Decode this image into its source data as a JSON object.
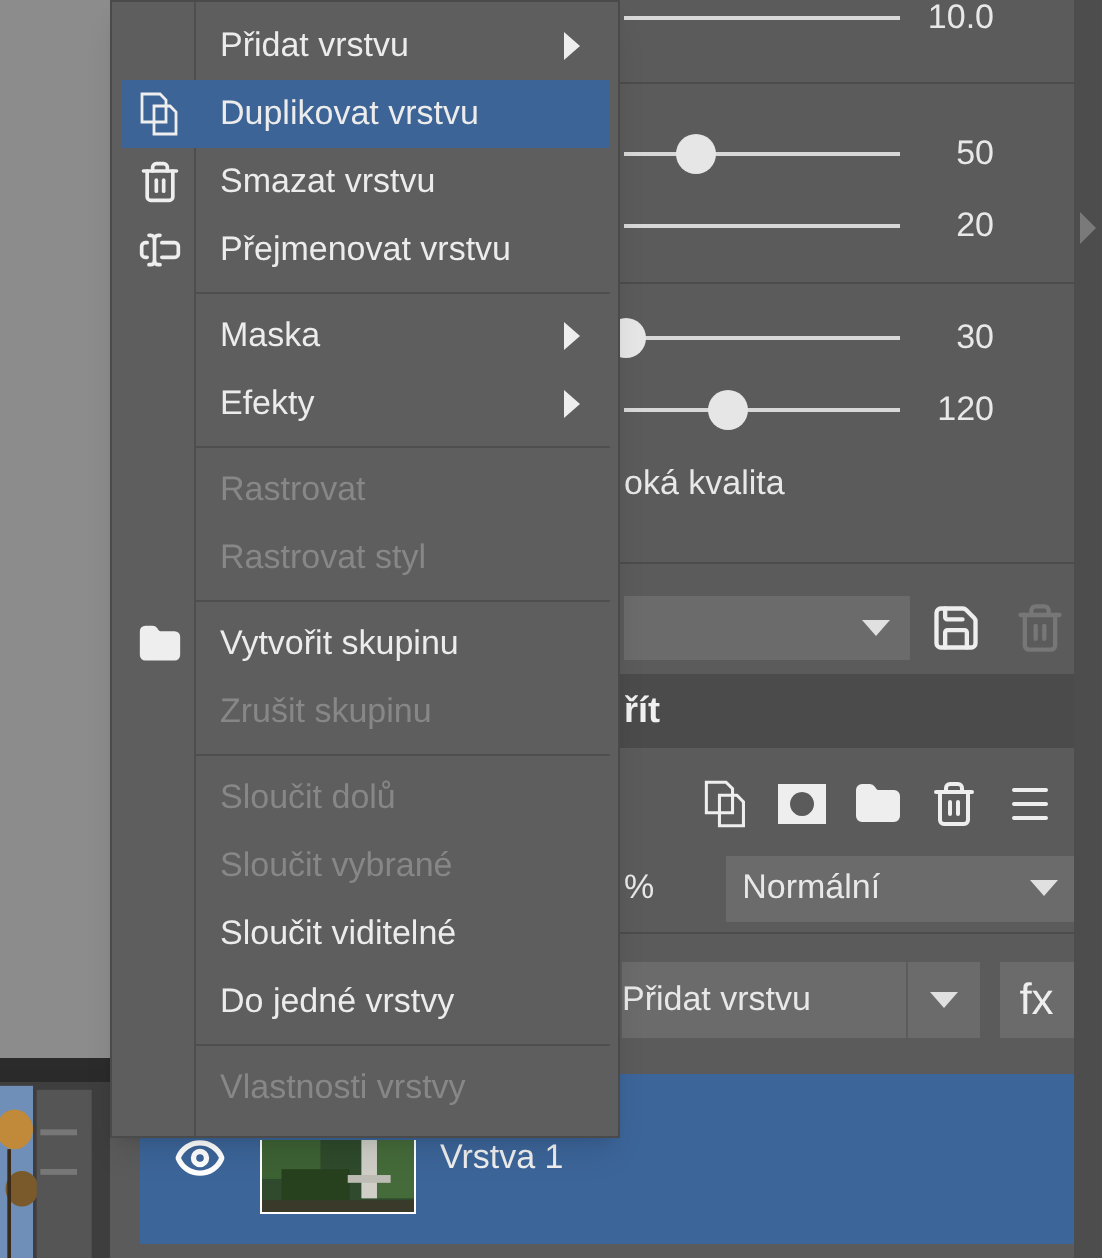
{
  "menu": {
    "sections": [
      [
        {
          "label": "Přidat vrstvu",
          "submenu": true,
          "disabled": false,
          "selected": false
        },
        {
          "label": "Duplikovat vrstvu",
          "submenu": false,
          "disabled": false,
          "selected": true
        },
        {
          "label": "Smazat vrstvu",
          "submenu": false,
          "disabled": false,
          "selected": false
        },
        {
          "label": "Přejmenovat vrstvu",
          "submenu": false,
          "disabled": false,
          "selected": false
        }
      ],
      [
        {
          "label": "Maska",
          "submenu": true,
          "disabled": false,
          "selected": false
        },
        {
          "label": "Efekty",
          "submenu": true,
          "disabled": false,
          "selected": false
        }
      ],
      [
        {
          "label": "Rastrovat",
          "submenu": false,
          "disabled": true,
          "selected": false
        },
        {
          "label": "Rastrovat styl",
          "submenu": false,
          "disabled": true,
          "selected": false
        }
      ],
      [
        {
          "label": "Vytvořit skupinu",
          "submenu": false,
          "disabled": false,
          "selected": false
        },
        {
          "label": "Zrušit skupinu",
          "submenu": false,
          "disabled": true,
          "selected": false
        }
      ],
      [
        {
          "label": "Sloučit dolů",
          "submenu": false,
          "disabled": true,
          "selected": false
        },
        {
          "label": "Sloučit vybrané",
          "submenu": false,
          "disabled": true,
          "selected": false
        },
        {
          "label": "Sloučit viditelné",
          "submenu": false,
          "disabled": false,
          "selected": false
        },
        {
          "label": "Do jedné vrstvy",
          "submenu": false,
          "disabled": false,
          "selected": false
        }
      ],
      [
        {
          "label": "Vlastnosti vrstvy",
          "submenu": false,
          "disabled": true,
          "selected": false
        }
      ]
    ]
  },
  "panel": {
    "slider_groups": [
      [
        {
          "value": "10.0"
        }
      ],
      [
        {
          "value": "50",
          "level": 0.26
        },
        {
          "value": "20"
        }
      ],
      [
        {
          "value": "30",
          "level": 0.01
        },
        {
          "value": "120",
          "level": 0.38
        }
      ]
    ],
    "quality_label": "oká kvalita",
    "section_header": "řít",
    "opacity_suffix": "%",
    "blend_mode": "Normální",
    "add_layer": "Přidat vrstvu",
    "fx_button": "fx",
    "layers": [
      {
        "name": "Vrstva 1",
        "selected": true,
        "visible": true
      }
    ]
  }
}
